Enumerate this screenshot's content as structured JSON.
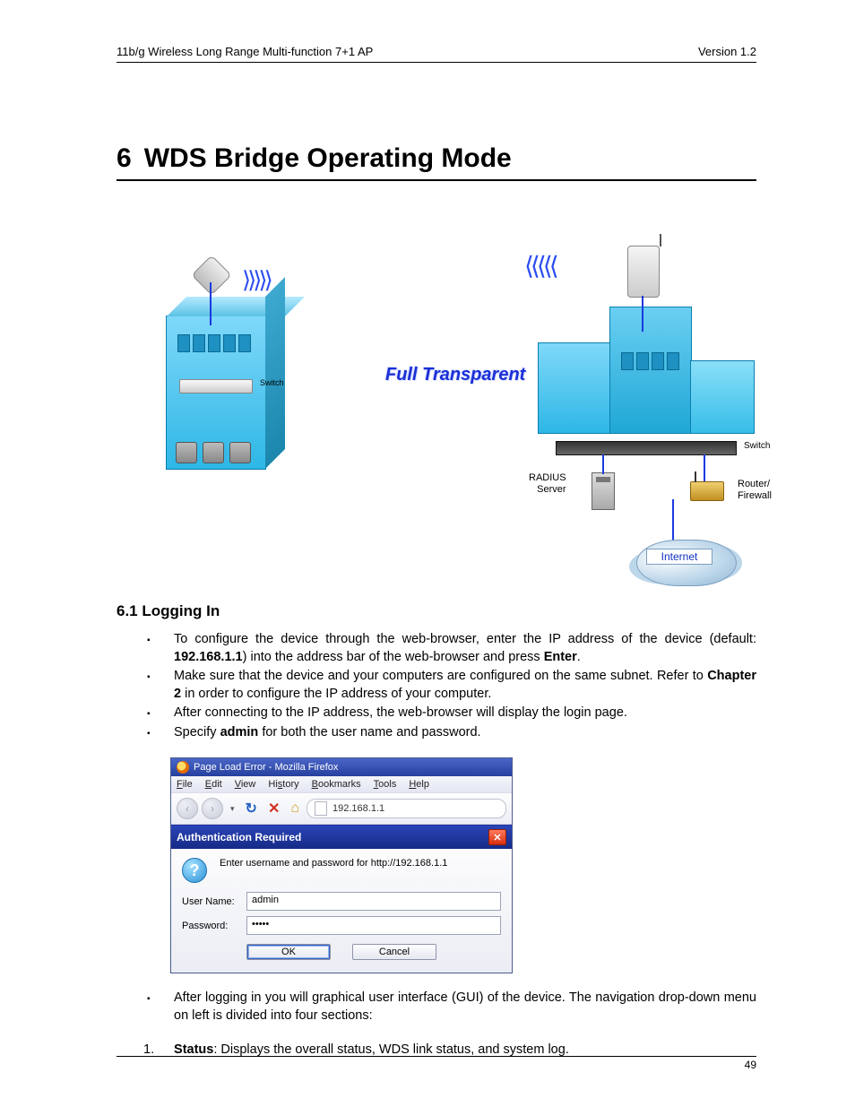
{
  "header": {
    "left": "11b/g Wireless Long Range Multi-function 7+1 AP",
    "right": "Version 1.2"
  },
  "chapter": {
    "number": "6",
    "title": "WDS Bridge Operating Mode"
  },
  "diagram": {
    "center_label": "Full Transparent",
    "left_switch_label": "Switch",
    "right_switch_label": "Switch",
    "radius_label_line1": "RADIUS",
    "radius_label_line2": "Server",
    "router_label_line1": "Router/",
    "router_label_line2": "Firewall",
    "internet_label": "Internet",
    "waves_out": "⟩⟩⟩⟩⟩",
    "waves_in": "⟨⟨⟨⟨⟨"
  },
  "section": {
    "heading": "6.1 Logging In"
  },
  "bullets": {
    "b1_pre": "To configure the device through the web-browser, enter the IP address of the device (default: ",
    "b1_ip": "192.168.1.1",
    "b1_mid": ") into the address bar of the web-browser and press ",
    "b1_enter": "Enter",
    "b1_post": ".",
    "b2_pre": "Make sure that the device and your computers are configured on the same subnet. Refer to ",
    "b2_bold": "Chapter 2",
    "b2_post": " in order to configure the IP address of your computer.",
    "b3": "After connecting to the IP address, the web-browser will display the login page.",
    "b4_pre": "Specify ",
    "b4_bold": "admin",
    "b4_post": " for both the user name and password."
  },
  "ff": {
    "window_title": "Page Load Error - Mozilla Firefox",
    "menu": {
      "file": "File",
      "edit": "Edit",
      "view": "View",
      "history": "History",
      "bookmarks": "Bookmarks",
      "tools": "Tools",
      "help": "Help"
    },
    "address_value": "192.168.1.1",
    "auth_title": "Authentication Required",
    "auth_msg": "Enter username and password for http://192.168.1.1",
    "username_label": "User Name:",
    "username_value": "admin",
    "password_label": "Password:",
    "password_value": "•••••",
    "ok": "OK",
    "cancel": "Cancel"
  },
  "after": {
    "b5": "After logging in you will graphical user interface (GUI) of the device. The navigation drop-down menu on left is divided into four sections:",
    "n1_num": "1.",
    "n1_bold": "Status",
    "n1_post": ": Displays the overall status, WDS link status, and system log."
  },
  "footer": {
    "page": "49"
  }
}
